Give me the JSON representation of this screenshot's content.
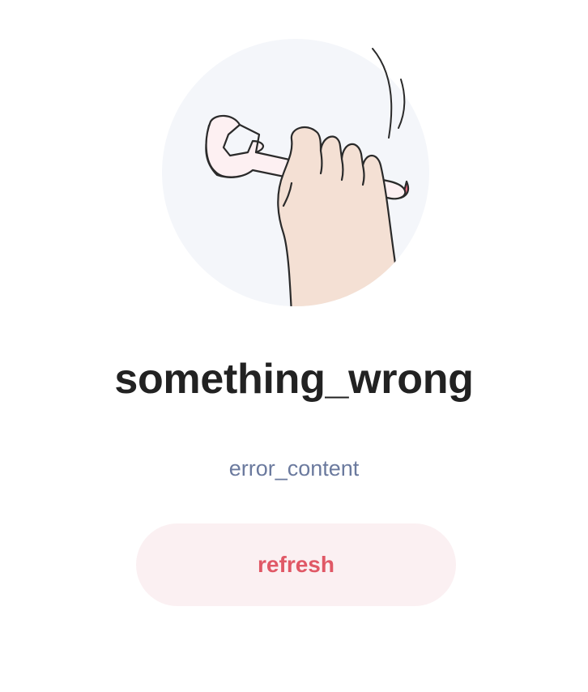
{
  "error": {
    "illustration": "wrench-hand-icon",
    "title": "something_wrong",
    "message": "error_content",
    "refresh_label": "refresh"
  },
  "colors": {
    "circle_bg": "#f4f6fa",
    "wrench_face": "#fdf0f2",
    "wrench_side": "#ee6a80",
    "skin": "#f4e0d4",
    "outline": "#2a2a2a",
    "title": "#222222",
    "message": "#6b7a9e",
    "button_bg": "#fbf0f2",
    "button_text": "#e05866"
  }
}
